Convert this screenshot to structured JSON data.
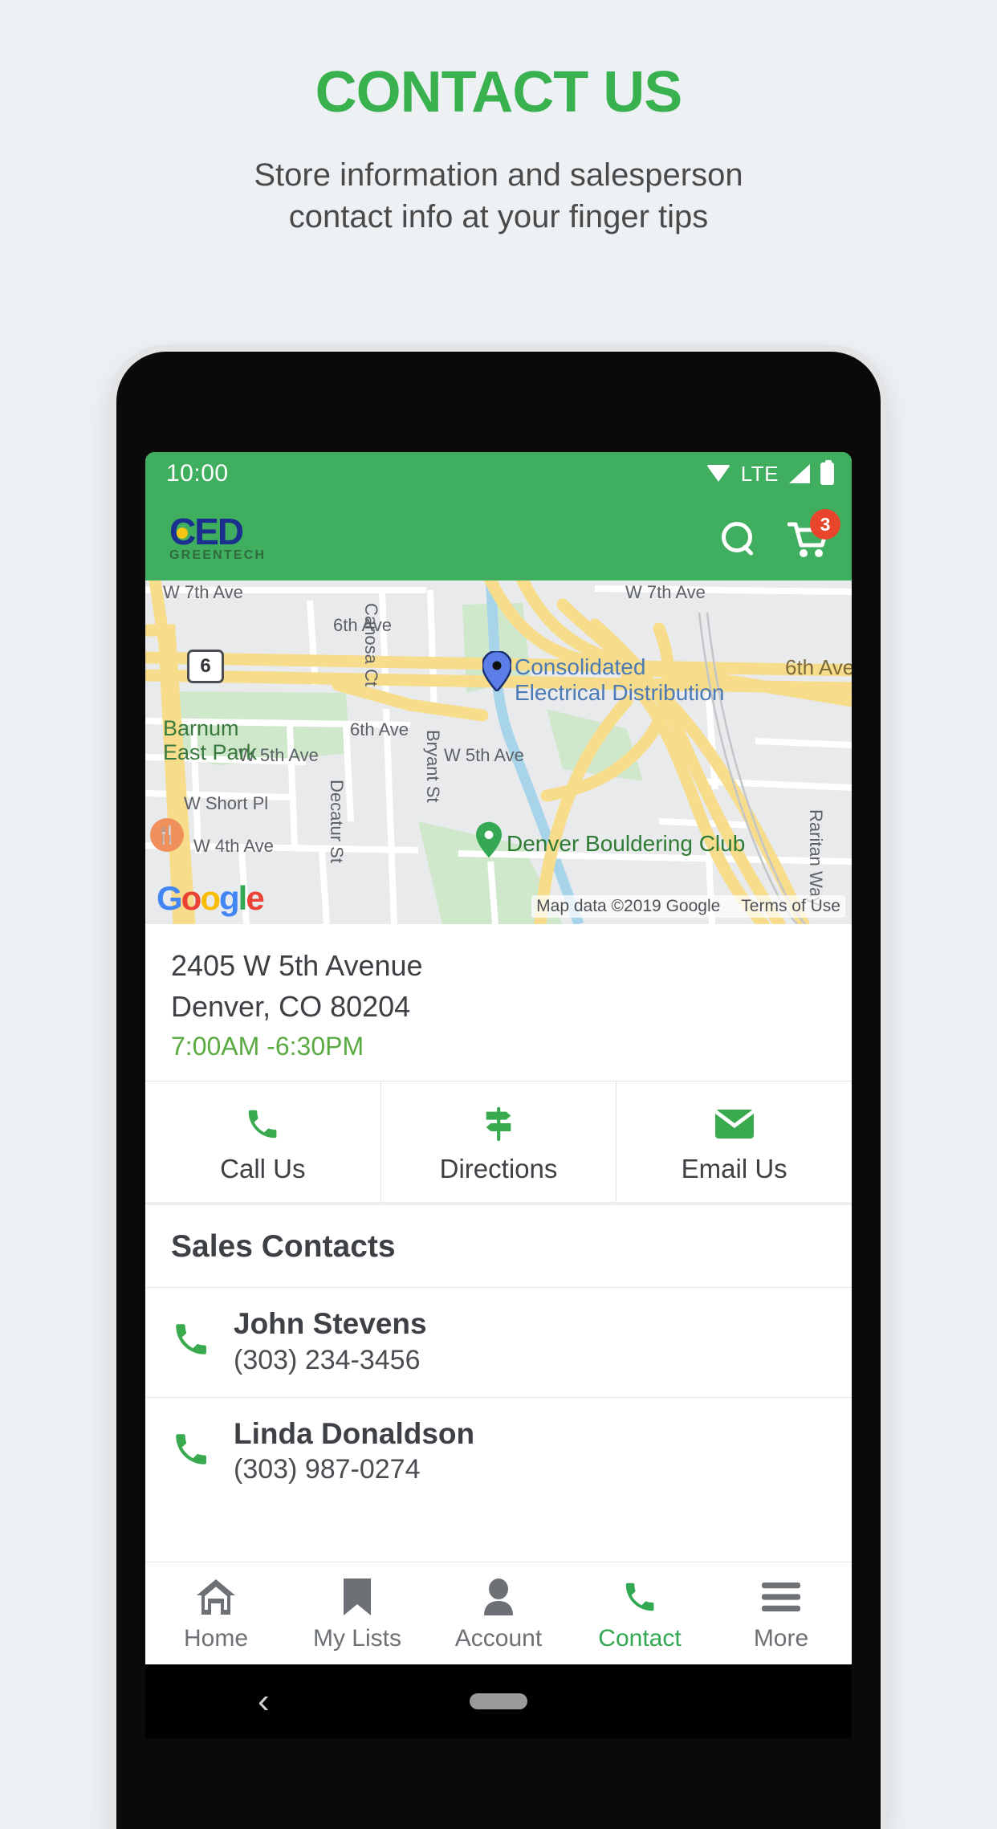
{
  "promo": {
    "title": "CONTACT US",
    "subtitle_line1": "Store information and salesperson",
    "subtitle_line2": "contact info at your finger tips",
    "title_color": "#3ab14f"
  },
  "statusbar": {
    "time": "10:00",
    "network_label": "LTE",
    "wifi_icon": "wifi-icon",
    "signal_icon": "signal-icon",
    "battery_icon": "battery-icon",
    "background": "#3fae5f"
  },
  "appbar": {
    "logo_main": "CED",
    "logo_sub": "GREENTECH",
    "logo_main_color": "#1b2f8f",
    "logo_sub_color": "#2f6b3c",
    "logo_dot_color": "#f5c518",
    "search_icon": "search-icon",
    "cart_icon": "shopping-cart-icon",
    "cart_badge": "3",
    "badge_color": "#e8452c"
  },
  "map": {
    "pin_primary_label_line1": "Consolidated",
    "pin_primary_label_line2": "Electrical Distribution",
    "pin_secondary_label": "Denver Bouldering Club",
    "park_label_line1": "Barnum",
    "park_label_line2": "East Park",
    "highway_shield": "6",
    "streets": [
      "W 7th Ave",
      "W 7th Ave",
      "Canosa Ct",
      "6th Ave",
      "6th Ave",
      "6th Ave",
      "Bryant St",
      "W 5th Ave",
      "W 5th Ave",
      "Decatur St",
      "W Short Pl",
      "W 4th Ave",
      "Raritan Way"
    ],
    "google_logo": "Google",
    "attribution": "Map data ©2019 Google",
    "terms": "Terms of Use"
  },
  "store": {
    "address_line1": "2405 W 5th Avenue",
    "address_line2": "Denver, CO 80204",
    "hours": "7:00AM -6:30PM",
    "hours_color": "#5aaa42"
  },
  "actions": [
    {
      "label": "Call Us",
      "icon": "phone-icon"
    },
    {
      "label": "Directions",
      "icon": "signpost-icon"
    },
    {
      "label": "Email Us",
      "icon": "envelope-icon"
    }
  ],
  "sales": {
    "section_title": "Sales Contacts",
    "contacts": [
      {
        "name": "John Stevens",
        "phone": "(303) 234-3456",
        "icon": "phone-icon"
      },
      {
        "name": "Linda Donaldson",
        "phone": "(303) 987-0274",
        "icon": "phone-icon"
      }
    ]
  },
  "bottom_nav": {
    "active_color": "#33a852",
    "items": [
      {
        "label": "Home",
        "icon": "home-icon",
        "active": false
      },
      {
        "label": "My Lists",
        "icon": "bookmark-icon",
        "active": false
      },
      {
        "label": "Account",
        "icon": "person-icon",
        "active": false
      },
      {
        "label": "Contact",
        "icon": "phone-icon",
        "active": true
      },
      {
        "label": "More",
        "icon": "hamburger-menu-icon",
        "active": false
      }
    ]
  },
  "system_nav": {
    "back_icon": "back-chevron-icon",
    "home_pill_icon": "home-pill-icon"
  }
}
